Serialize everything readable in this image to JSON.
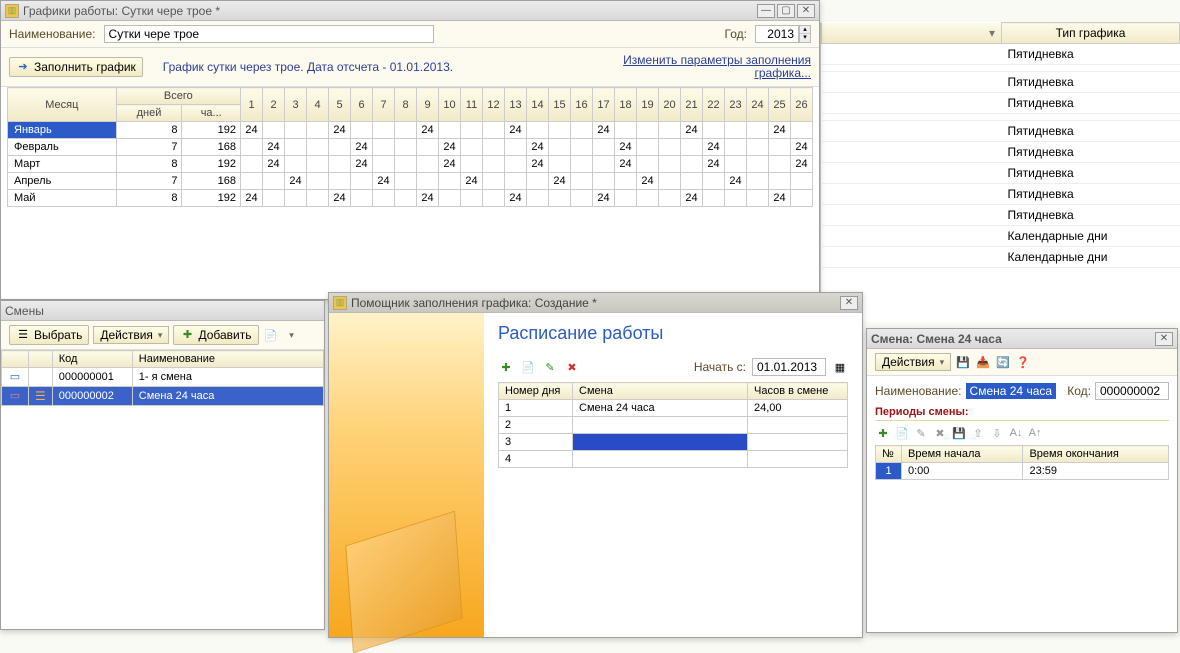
{
  "schedule_window": {
    "title": "Графики работы: Сутки чере трое *",
    "name_label": "Наименование:",
    "name_value": "Сутки чере трое",
    "year_label": "Год:",
    "year_value": "2013",
    "fill_button": "Заполнить график",
    "description": "График сутки через трое. Дата отсчета - 01.01.2013.",
    "change_link": "Изменить параметры заполнения графика...",
    "headers": {
      "month": "Месяц",
      "total": "Всего",
      "days": "дней",
      "hours": "ча..."
    },
    "day_nums": [
      "1",
      "2",
      "3",
      "4",
      "5",
      "6",
      "7",
      "8",
      "9",
      "10",
      "11",
      "12",
      "13",
      "14",
      "15",
      "16",
      "17",
      "18",
      "19",
      "20",
      "21",
      "22",
      "23",
      "24",
      "25",
      "26"
    ],
    "rows": [
      {
        "month": "Январь",
        "days": "8",
        "hours": "192",
        "sel": true,
        "cells": [
          {
            "v": "24"
          },
          {
            "v": ""
          },
          {
            "v": ""
          },
          {
            "v": ""
          },
          {
            "v": "24",
            "w": 1
          },
          {
            "v": "",
            "w": 1
          },
          {
            "v": ""
          },
          {
            "v": ""
          },
          {
            "v": "24"
          },
          {
            "v": ""
          },
          {
            "v": ""
          },
          {
            "v": "",
            "w": 1
          },
          {
            "v": "24",
            "w": 1
          },
          {
            "v": ""
          },
          {
            "v": ""
          },
          {
            "v": ""
          },
          {
            "v": "24"
          },
          {
            "v": ""
          },
          {
            "v": "",
            "w": 1
          },
          {
            "v": "",
            "w": 1
          },
          {
            "v": "24"
          },
          {
            "v": ""
          },
          {
            "v": ""
          },
          {
            "v": ""
          },
          {
            "v": "24"
          },
          {
            "v": "",
            "w": 1
          }
        ]
      },
      {
        "month": "Февраль",
        "days": "7",
        "hours": "168",
        "cells": [
          {
            "v": ""
          },
          {
            "v": "24",
            "w": 1
          },
          {
            "v": "",
            "w": 1
          },
          {
            "v": ""
          },
          {
            "v": ""
          },
          {
            "v": "24"
          },
          {
            "v": ""
          },
          {
            "v": ""
          },
          {
            "v": "",
            "w": 1
          },
          {
            "v": "24",
            "w": 1
          },
          {
            "v": ""
          },
          {
            "v": ""
          },
          {
            "v": ""
          },
          {
            "v": "24"
          },
          {
            "v": ""
          },
          {
            "v": "",
            "w": 1
          },
          {
            "v": "",
            "w": 1
          },
          {
            "v": "24"
          },
          {
            "v": ""
          },
          {
            "v": ""
          },
          {
            "v": ""
          },
          {
            "v": "24"
          },
          {
            "v": "",
            "w": 1
          },
          {
            "v": "",
            "w": 1
          },
          {
            "v": ""
          },
          {
            "v": "24"
          }
        ]
      },
      {
        "month": "Март",
        "days": "8",
        "hours": "192",
        "cells": [
          {
            "v": ""
          },
          {
            "v": "24",
            "w": 1
          },
          {
            "v": "",
            "w": 1
          },
          {
            "v": ""
          },
          {
            "v": ""
          },
          {
            "v": "24"
          },
          {
            "v": ""
          },
          {
            "v": ""
          },
          {
            "v": "",
            "w": 1
          },
          {
            "v": "24",
            "w": 1
          },
          {
            "v": ""
          },
          {
            "v": ""
          },
          {
            "v": ""
          },
          {
            "v": "24"
          },
          {
            "v": ""
          },
          {
            "v": "",
            "w": 1
          },
          {
            "v": "",
            "w": 1
          },
          {
            "v": "24"
          },
          {
            "v": ""
          },
          {
            "v": ""
          },
          {
            "v": ""
          },
          {
            "v": "24"
          },
          {
            "v": "",
            "w": 1
          },
          {
            "v": "",
            "w": 1
          },
          {
            "v": ""
          },
          {
            "v": "24"
          }
        ]
      },
      {
        "month": "Апрель",
        "days": "7",
        "hours": "168",
        "cells": [
          {
            "v": ""
          },
          {
            "v": ""
          },
          {
            "v": "24"
          },
          {
            "v": ""
          },
          {
            "v": ""
          },
          {
            "v": "",
            "w": 1
          },
          {
            "v": "24",
            "w": 1
          },
          {
            "v": ""
          },
          {
            "v": ""
          },
          {
            "v": ""
          },
          {
            "v": "24"
          },
          {
            "v": ""
          },
          {
            "v": "",
            "w": 1
          },
          {
            "v": "",
            "w": 1
          },
          {
            "v": "24"
          },
          {
            "v": ""
          },
          {
            "v": ""
          },
          {
            "v": ""
          },
          {
            "v": "24"
          },
          {
            "v": "",
            "w": 1
          },
          {
            "v": "",
            "w": 1
          },
          {
            "v": ""
          },
          {
            "v": "24"
          },
          {
            "v": ""
          },
          {
            "v": ""
          },
          {
            "v": ""
          }
        ]
      },
      {
        "month": "Май",
        "days": "8",
        "hours": "192",
        "cells": [
          {
            "v": "24",
            "w": 1
          },
          {
            "v": ""
          },
          {
            "v": ""
          },
          {
            "v": "",
            "w": 1
          },
          {
            "v": "24",
            "w": 1
          },
          {
            "v": ""
          },
          {
            "v": ""
          },
          {
            "v": ""
          },
          {
            "v": "24",
            "w": 1
          },
          {
            "v": ""
          },
          {
            "v": "",
            "w": 1
          },
          {
            "v": "",
            "w": 1
          },
          {
            "v": "24"
          },
          {
            "v": ""
          },
          {
            "v": ""
          },
          {
            "v": ""
          },
          {
            "v": "24"
          },
          {
            "v": "",
            "w": 1
          },
          {
            "v": "",
            "w": 1
          },
          {
            "v": ""
          },
          {
            "v": "24"
          },
          {
            "v": ""
          },
          {
            "v": ""
          },
          {
            "v": ""
          },
          {
            "v": "24",
            "w": 1
          },
          {
            "v": "",
            "w": 1
          }
        ]
      }
    ]
  },
  "right_list": {
    "header": "Тип графика",
    "items": [
      "Пятидневка",
      "",
      "Пятидневка",
      "Пятидневка",
      "",
      "Пятидневка",
      "Пятидневка",
      "Пятидневка",
      "Пятидневка",
      "Пятидневка",
      "Календарные дни",
      "Календарные дни"
    ]
  },
  "shifts_window": {
    "title": "Смены",
    "select_btn": "Выбрать",
    "actions_btn": "Действия",
    "add_btn": "Добавить",
    "cols": {
      "code": "Код",
      "name": "Наименование"
    },
    "rows": [
      {
        "code": "000000001",
        "name": "1- я смена",
        "sel": false
      },
      {
        "code": "000000002",
        "name": "Смена 24 часа",
        "sel": true
      }
    ]
  },
  "wizard_window": {
    "title": "Помощник заполнения графика: Создание *",
    "heading": "Расписание работы",
    "start_label": "Начать с:",
    "start_value": "01.01.2013",
    "cols": {
      "day": "Номер дня",
      "shift": "Смена",
      "hours": "Часов в смене"
    },
    "rows": [
      {
        "n": "1",
        "shift": "Смена 24 часа",
        "h": "24,00"
      },
      {
        "n": "2",
        "shift": "",
        "h": ""
      },
      {
        "n": "3",
        "shift": "",
        "h": "",
        "sel": true
      },
      {
        "n": "4",
        "shift": "",
        "h": ""
      }
    ]
  },
  "shift_detail": {
    "title": "Смена: Смена 24 часа",
    "actions": "Действия",
    "name_label": "Наименование:",
    "name_value": "Смена 24 часа",
    "code_label": "Код:",
    "code_value": "000000002",
    "section": "Периоды смены:",
    "cols": {
      "n": "№",
      "start": "Время начала",
      "end": "Время окончания"
    },
    "rows": [
      {
        "n": "1",
        "start": "0:00",
        "end": "23:59"
      }
    ]
  }
}
